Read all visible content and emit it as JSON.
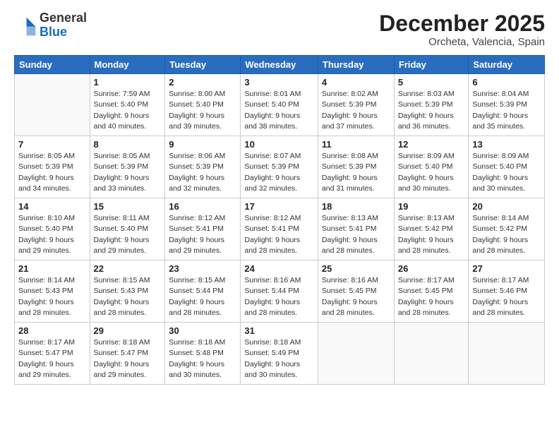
{
  "header": {
    "logo_line1": "General",
    "logo_line2": "Blue",
    "month": "December 2025",
    "location": "Orcheta, Valencia, Spain"
  },
  "days_of_week": [
    "Sunday",
    "Monday",
    "Tuesday",
    "Wednesday",
    "Thursday",
    "Friday",
    "Saturday"
  ],
  "weeks": [
    [
      {
        "day": "",
        "info": ""
      },
      {
        "day": "1",
        "info": "Sunrise: 7:59 AM\nSunset: 5:40 PM\nDaylight: 9 hours\nand 40 minutes."
      },
      {
        "day": "2",
        "info": "Sunrise: 8:00 AM\nSunset: 5:40 PM\nDaylight: 9 hours\nand 39 minutes."
      },
      {
        "day": "3",
        "info": "Sunrise: 8:01 AM\nSunset: 5:40 PM\nDaylight: 9 hours\nand 38 minutes."
      },
      {
        "day": "4",
        "info": "Sunrise: 8:02 AM\nSunset: 5:39 PM\nDaylight: 9 hours\nand 37 minutes."
      },
      {
        "day": "5",
        "info": "Sunrise: 8:03 AM\nSunset: 5:39 PM\nDaylight: 9 hours\nand 36 minutes."
      },
      {
        "day": "6",
        "info": "Sunrise: 8:04 AM\nSunset: 5:39 PM\nDaylight: 9 hours\nand 35 minutes."
      }
    ],
    [
      {
        "day": "7",
        "info": "Sunrise: 8:05 AM\nSunset: 5:39 PM\nDaylight: 9 hours\nand 34 minutes."
      },
      {
        "day": "8",
        "info": "Sunrise: 8:05 AM\nSunset: 5:39 PM\nDaylight: 9 hours\nand 33 minutes."
      },
      {
        "day": "9",
        "info": "Sunrise: 8:06 AM\nSunset: 5:39 PM\nDaylight: 9 hours\nand 32 minutes."
      },
      {
        "day": "10",
        "info": "Sunrise: 8:07 AM\nSunset: 5:39 PM\nDaylight: 9 hours\nand 32 minutes."
      },
      {
        "day": "11",
        "info": "Sunrise: 8:08 AM\nSunset: 5:39 PM\nDaylight: 9 hours\nand 31 minutes."
      },
      {
        "day": "12",
        "info": "Sunrise: 8:09 AM\nSunset: 5:40 PM\nDaylight: 9 hours\nand 30 minutes."
      },
      {
        "day": "13",
        "info": "Sunrise: 8:09 AM\nSunset: 5:40 PM\nDaylight: 9 hours\nand 30 minutes."
      }
    ],
    [
      {
        "day": "14",
        "info": "Sunrise: 8:10 AM\nSunset: 5:40 PM\nDaylight: 9 hours\nand 29 minutes."
      },
      {
        "day": "15",
        "info": "Sunrise: 8:11 AM\nSunset: 5:40 PM\nDaylight: 9 hours\nand 29 minutes."
      },
      {
        "day": "16",
        "info": "Sunrise: 8:12 AM\nSunset: 5:41 PM\nDaylight: 9 hours\nand 29 minutes."
      },
      {
        "day": "17",
        "info": "Sunrise: 8:12 AM\nSunset: 5:41 PM\nDaylight: 9 hours\nand 28 minutes."
      },
      {
        "day": "18",
        "info": "Sunrise: 8:13 AM\nSunset: 5:41 PM\nDaylight: 9 hours\nand 28 minutes."
      },
      {
        "day": "19",
        "info": "Sunrise: 8:13 AM\nSunset: 5:42 PM\nDaylight: 9 hours\nand 28 minutes."
      },
      {
        "day": "20",
        "info": "Sunrise: 8:14 AM\nSunset: 5:42 PM\nDaylight: 9 hours\nand 28 minutes."
      }
    ],
    [
      {
        "day": "21",
        "info": "Sunrise: 8:14 AM\nSunset: 5:43 PM\nDaylight: 9 hours\nand 28 minutes."
      },
      {
        "day": "22",
        "info": "Sunrise: 8:15 AM\nSunset: 5:43 PM\nDaylight: 9 hours\nand 28 minutes."
      },
      {
        "day": "23",
        "info": "Sunrise: 8:15 AM\nSunset: 5:44 PM\nDaylight: 9 hours\nand 28 minutes."
      },
      {
        "day": "24",
        "info": "Sunrise: 8:16 AM\nSunset: 5:44 PM\nDaylight: 9 hours\nand 28 minutes."
      },
      {
        "day": "25",
        "info": "Sunrise: 8:16 AM\nSunset: 5:45 PM\nDaylight: 9 hours\nand 28 minutes."
      },
      {
        "day": "26",
        "info": "Sunrise: 8:17 AM\nSunset: 5:45 PM\nDaylight: 9 hours\nand 28 minutes."
      },
      {
        "day": "27",
        "info": "Sunrise: 8:17 AM\nSunset: 5:46 PM\nDaylight: 9 hours\nand 28 minutes."
      }
    ],
    [
      {
        "day": "28",
        "info": "Sunrise: 8:17 AM\nSunset: 5:47 PM\nDaylight: 9 hours\nand 29 minutes."
      },
      {
        "day": "29",
        "info": "Sunrise: 8:18 AM\nSunset: 5:47 PM\nDaylight: 9 hours\nand 29 minutes."
      },
      {
        "day": "30",
        "info": "Sunrise: 8:18 AM\nSunset: 5:48 PM\nDaylight: 9 hours\nand 30 minutes."
      },
      {
        "day": "31",
        "info": "Sunrise: 8:18 AM\nSunset: 5:49 PM\nDaylight: 9 hours\nand 30 minutes."
      },
      {
        "day": "",
        "info": ""
      },
      {
        "day": "",
        "info": ""
      },
      {
        "day": "",
        "info": ""
      }
    ]
  ]
}
